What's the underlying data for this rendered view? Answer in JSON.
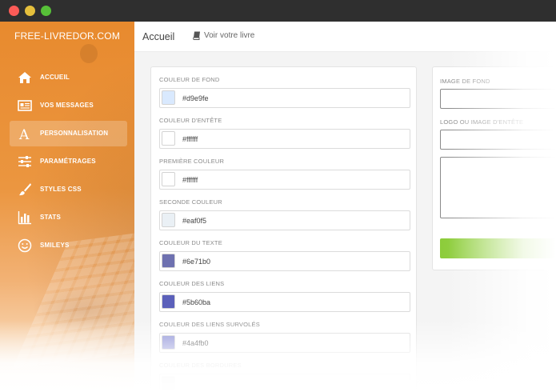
{
  "window": {
    "controls": [
      "close",
      "minimize",
      "maximize"
    ]
  },
  "sidebar": {
    "brand": "FREE-LIVREDOR.COM",
    "items": [
      {
        "label": "ACCUEIL",
        "icon": "home-icon",
        "active": false
      },
      {
        "label": "VOS MESSAGES",
        "icon": "newspaper-icon",
        "active": false
      },
      {
        "label": "PERSONNALISATION",
        "icon": "letter-a-icon",
        "active": true
      },
      {
        "label": "PARAMÉTRAGES",
        "icon": "sliders-icon",
        "active": false
      },
      {
        "label": "STYLES CSS",
        "icon": "paintbrush-icon",
        "active": false
      },
      {
        "label": "STATS",
        "icon": "bar-chart-icon",
        "active": false
      },
      {
        "label": "SMILEYS",
        "icon": "smiley-icon",
        "active": false
      }
    ]
  },
  "header": {
    "title": "Accueil",
    "link_label": "Voir votre livre",
    "link_icon": "book-icon"
  },
  "form": {
    "fields": [
      {
        "label": "COULEUR DE FOND",
        "value": "#d9e9fe",
        "color": "#d9e9fe"
      },
      {
        "label": "COULEUR D'ENTÊTE",
        "value": "#ffffff",
        "color": "#ffffff"
      },
      {
        "label": "PREMIÈRE COULEUR",
        "value": "#ffffff",
        "color": "#ffffff"
      },
      {
        "label": "SECONDE COULEUR",
        "value": "#eaf0f5",
        "color": "#eaf0f5"
      },
      {
        "label": "COULEUR DU TEXTE",
        "value": "#6e71b0",
        "color": "#6e71b0"
      },
      {
        "label": "COULEUR DES LIENS",
        "value": "#5b60ba",
        "color": "#5b60ba"
      },
      {
        "label": "COULEUR DES LIENS SURVOLÉS",
        "value": "#4a4fb0",
        "color": "#8a8fd6"
      },
      {
        "label": "COULEUR DES BORDURES",
        "value": "",
        "color": "#cccccc"
      }
    ]
  },
  "right_panel": {
    "image_label": "IMAGE DE FOND",
    "logo_label": "LOGO OU IMAGE D'ENTÊTE"
  },
  "colors": {
    "sidebar_accent": "#e88a2e",
    "button_green": "#8ccc3a"
  }
}
